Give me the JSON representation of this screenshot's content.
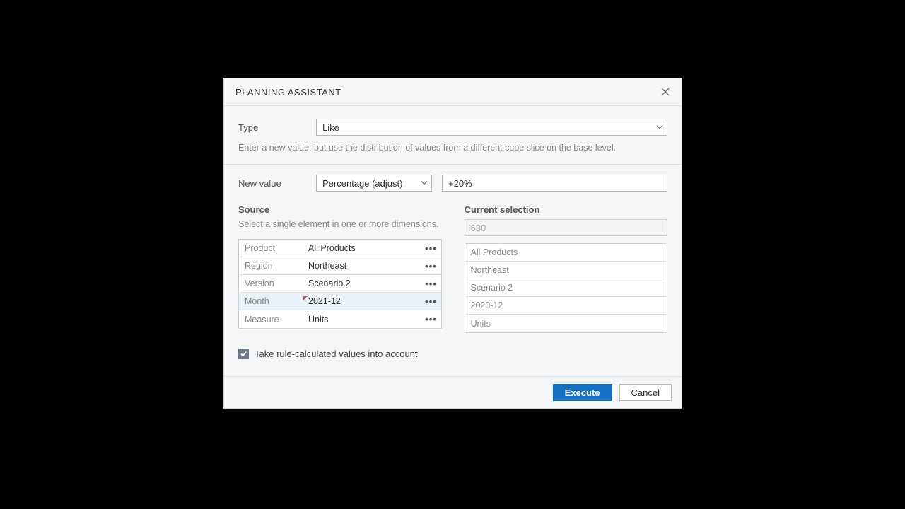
{
  "dialog": {
    "title": "PLANNING ASSISTANT"
  },
  "type": {
    "label": "Type",
    "value": "Like",
    "hint": "Enter a new value, but use the distribution of values from a different cube slice on the base level."
  },
  "newValue": {
    "label": "New value",
    "mode": "Percentage (adjust)",
    "value": "+20%"
  },
  "source": {
    "title": "Source",
    "hint": "Select a single element in one or more dimensions.",
    "rows": [
      {
        "dim": "Product",
        "val": "All Products",
        "highlight": false,
        "marker": false
      },
      {
        "dim": "Region",
        "val": "Northeast",
        "highlight": false,
        "marker": false
      },
      {
        "dim": "Version",
        "val": "Scenario 2",
        "highlight": false,
        "marker": false
      },
      {
        "dim": "Month",
        "val": "2021-12",
        "highlight": true,
        "marker": true
      },
      {
        "dim": "Measure",
        "val": "Units",
        "highlight": false,
        "marker": false
      }
    ]
  },
  "selection": {
    "title": "Current selection",
    "preview": "630",
    "rows": [
      "All Products",
      "Northeast",
      "Scenario 2",
      "2020-12",
      "Units"
    ]
  },
  "checkbox": {
    "checked": true,
    "label": "Take rule-calculated values into account"
  },
  "footer": {
    "execute": "Execute",
    "cancel": "Cancel"
  }
}
